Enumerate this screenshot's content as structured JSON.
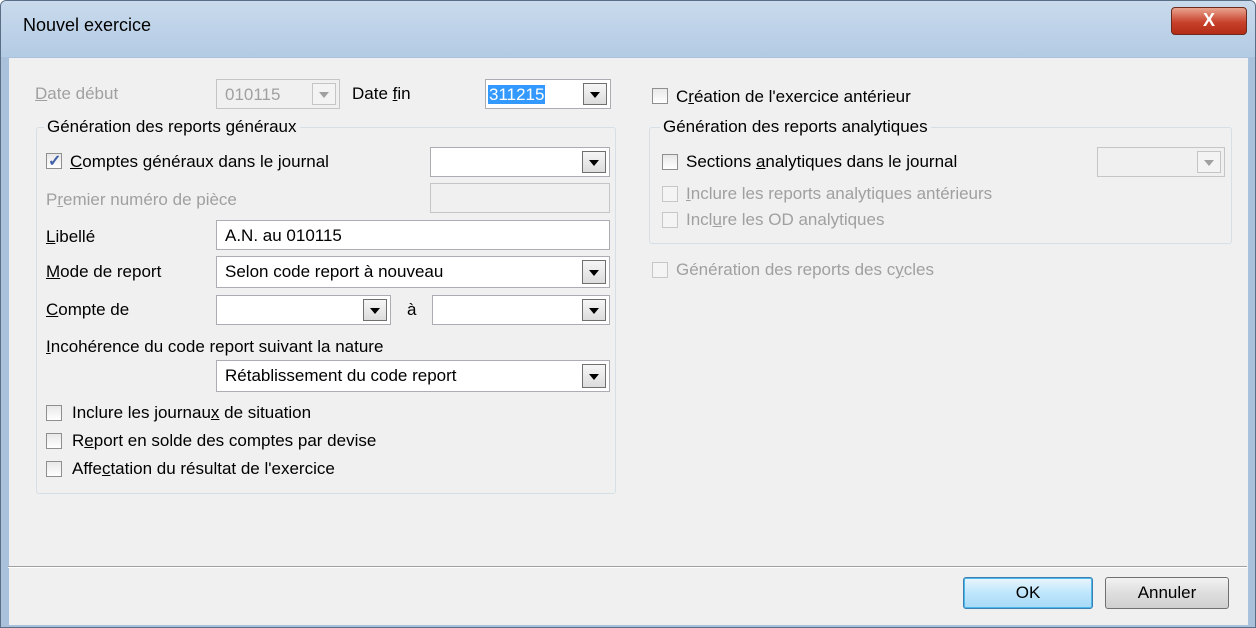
{
  "window": {
    "title": "Nouvel exercice",
    "close_glyph": "X"
  },
  "dates": {
    "start_label_pre": "",
    "start_label_ul": "D",
    "start_label_post": "ate début",
    "start_value": "010115",
    "end_label_pre": "Date ",
    "end_label_ul": "f",
    "end_label_post": "in",
    "end_value": "311215"
  },
  "general": {
    "group_title": "Génération des reports généraux",
    "comptes_checkbox": {
      "pre": "",
      "ul": "C",
      "post": "omptes généraux dans le journal",
      "checked": true
    },
    "comptes_journal_value": "",
    "premier_label": {
      "pre": "P",
      "ul": "r",
      "post": "emier numéro de pièce"
    },
    "premier_value": "",
    "libelle_label": {
      "pre": "",
      "ul": "L",
      "post": "ibellé"
    },
    "libelle_value": "A.N. au 010115",
    "mode_label": {
      "pre": "",
      "ul": "M",
      "post": "ode de report"
    },
    "mode_value": "Selon code report à nouveau",
    "compte_de_label": {
      "pre": "",
      "ul": "C",
      "post": "ompte de"
    },
    "compte_de_value": "",
    "a_label": "à",
    "compte_a_value": "",
    "incoherence_label": {
      "pre": "",
      "ul": "I",
      "post": "ncohérence du code report suivant la nature"
    },
    "incoherence_value": "Rétablissement du code report",
    "journaux_situation": {
      "pre": "Inclure les journau",
      "ul": "x",
      "post": " de situation",
      "checked": false
    },
    "report_solde": {
      "pre": "R",
      "ul": "e",
      "post": "port en solde des comptes par devise",
      "checked": false
    },
    "affectation": {
      "pre": "Affe",
      "ul": "c",
      "post": "tation du résultat de l'exercice",
      "checked": false
    }
  },
  "right": {
    "creation_anterieur": {
      "pre": "C",
      "ul": "r",
      "post": "éation de l'exercice antérieur",
      "checked": false
    },
    "analytic_group_title": "Génération des reports analytiques",
    "sections": {
      "pre": "Sections ",
      "ul": "a",
      "post": "nalytiques dans le journal",
      "checked": false
    },
    "sections_value": "",
    "inclure_reports": {
      "pre": "",
      "ul": "I",
      "post": "nclure les reports analytiques antérieurs",
      "checked": false
    },
    "inclure_od": {
      "pre": "Incl",
      "ul": "u",
      "post": "re les OD analytiques",
      "checked": false
    },
    "cycles": {
      "pre": "Génération des reports des c",
      "ul": "y",
      "post": "cles",
      "checked": false
    }
  },
  "buttons": {
    "ok": "OK",
    "cancel": "Annuler"
  },
  "colors": {
    "selection": "#3399ff",
    "title_bar": "#b9cfe6",
    "dialog_bg": "#f0f0f0",
    "checkmark": "#4060a8"
  }
}
